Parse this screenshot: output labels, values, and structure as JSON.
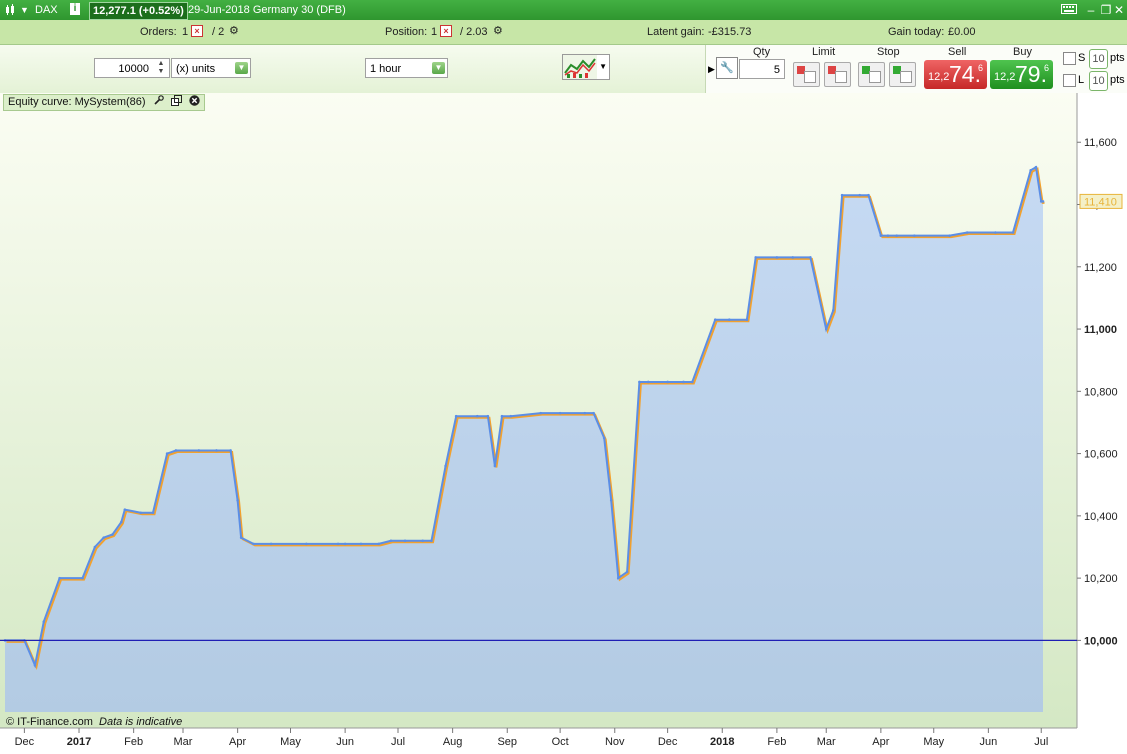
{
  "titlebar": {
    "instrument": "DAX",
    "info_icon": "i",
    "price_change": "12,277.1 (+0.52%)",
    "description": "29-Jun-2018 Germany 30 (DFB)"
  },
  "infobar": {
    "orders_label": "Orders:",
    "orders_a": "1",
    "orders_b": "/ 2",
    "position_label": "Position:",
    "position_a": "1",
    "position_b": "/ 2.03",
    "latent_label": "Latent gain:",
    "latent_value": "-£315.73",
    "gaintoday_label": "Gain today:",
    "gaintoday_value": "£0.00"
  },
  "toolbar": {
    "quantity": "10000",
    "unit_select": "(x) units",
    "timeframe_select": "1 hour"
  },
  "trade": {
    "qty_label": "Qty",
    "qty_value": "5",
    "limit_label": "Limit",
    "stop_label": "Stop",
    "sell_label": "Sell",
    "buy_label": "Buy",
    "sell_small": "12,2",
    "sell_big": "74.",
    "sell_sup": "6",
    "buy_small": "12,2",
    "buy_big": "79.",
    "buy_sup": "6",
    "s_label": "S",
    "l_label": "L",
    "s_pts": "10",
    "l_pts": "10",
    "pts_label": "pts"
  },
  "chart": {
    "equity_label": "Equity curve: MySystem(86)",
    "footer_brand": "© IT-Finance.com",
    "footer_note": "Data is indicative"
  },
  "colors": {
    "area_fill": "#bcd3ec",
    "blue_line": "#5b8ee6",
    "orange_line": "#f2a12e",
    "baseline": "#1f1fb4",
    "last_value": "#e8b43a"
  },
  "chart_data": {
    "type": "line",
    "title": "Equity curve: MySystem(86)",
    "xlabel": "",
    "ylabel": "",
    "x_tick_labels": [
      "Dec",
      "2017",
      "Feb",
      "Mar",
      "Apr",
      "May",
      "Jun",
      "Jul",
      "Aug",
      "Sep",
      "Oct",
      "Nov",
      "Dec",
      "2018",
      "Feb",
      "Mar",
      "Apr",
      "May",
      "Jun",
      "Jul"
    ],
    "x_tick_dates": [
      "2016-12-01",
      "2017-01-01",
      "2017-02-01",
      "2017-03-01",
      "2017-04-01",
      "2017-05-01",
      "2017-06-01",
      "2017-07-01",
      "2017-08-01",
      "2017-09-01",
      "2017-10-01",
      "2017-11-01",
      "2017-12-01",
      "2018-01-01",
      "2018-02-01",
      "2018-03-01",
      "2018-04-01",
      "2018-05-01",
      "2018-06-01",
      "2018-07-01"
    ],
    "y_tick_labels": [
      "10,000",
      "10,200",
      "10,400",
      "10,600",
      "10,800",
      "11,000",
      "11,200",
      "11,400",
      "11,600"
    ],
    "y_ticks": [
      10000,
      10200,
      10400,
      10600,
      10800,
      11000,
      11200,
      11400,
      11600
    ],
    "ylim": [
      9770,
      11710
    ],
    "baseline": 10000,
    "last_value": 11410,
    "last_value_label": "11,410",
    "grid": false,
    "series": [
      {
        "x": [
          "2016-11-20",
          "2016-12-01",
          "2016-12-07",
          "2016-12-12",
          "2016-12-21",
          "2017-01-03",
          "2017-01-10",
          "2017-01-15",
          "2017-01-20",
          "2017-01-25",
          "2017-01-27",
          "2017-02-05",
          "2017-02-12",
          "2017-02-20",
          "2017-02-25",
          "2017-03-10",
          "2017-03-20",
          "2017-03-28",
          "2017-04-01",
          "2017-04-03",
          "2017-04-10",
          "2017-04-20",
          "2017-05-10",
          "2017-05-28",
          "2017-06-01",
          "2017-06-10",
          "2017-06-20",
          "2017-06-27",
          "2017-07-05",
          "2017-07-15",
          "2017-07-20",
          "2017-07-28",
          "2017-08-03",
          "2017-08-15",
          "2017-08-21",
          "2017-08-25",
          "2017-08-29",
          "2017-09-03",
          "2017-09-20",
          "2017-10-01",
          "2017-10-15",
          "2017-10-20",
          "2017-10-26",
          "2017-10-30",
          "2017-11-03",
          "2017-11-08",
          "2017-11-15",
          "2017-11-20",
          "2017-12-01",
          "2017-12-10",
          "2017-12-15",
          "2017-12-28",
          "2018-01-05",
          "2018-01-15",
          "2018-01-20",
          "2018-02-01",
          "2018-02-10",
          "2018-02-20",
          "2018-03-01",
          "2018-03-05",
          "2018-03-10",
          "2018-03-20",
          "2018-03-25",
          "2018-04-01",
          "2018-04-05",
          "2018-04-10",
          "2018-04-20",
          "2018-05-10",
          "2018-05-20",
          "2018-06-05",
          "2018-06-15",
          "2018-06-25",
          "2018-06-28",
          "2018-07-01",
          "2018-07-02"
        ],
        "y": [
          10000,
          10000,
          9920,
          10060,
          10200,
          10200,
          10300,
          10330,
          10340,
          10380,
          10420,
          10410,
          10410,
          10600,
          10610,
          10610,
          10610,
          10610,
          10450,
          10330,
          10310,
          10310,
          10310,
          10310,
          10310,
          10310,
          10310,
          10320,
          10320,
          10320,
          10320,
          10560,
          10720,
          10720,
          10720,
          10560,
          10720,
          10720,
          10730,
          10730,
          10730,
          10730,
          10650,
          10450,
          10200,
          10220,
          10830,
          10830,
          10830,
          10830,
          10830,
          11030,
          11030,
          11030,
          11230,
          11230,
          11230,
          11230,
          11000,
          11060,
          11430,
          11430,
          11430,
          11300,
          11300,
          11300,
          11300,
          11300,
          11310,
          11310,
          11310,
          11510,
          11520,
          11410,
          11410
        ]
      }
    ]
  }
}
